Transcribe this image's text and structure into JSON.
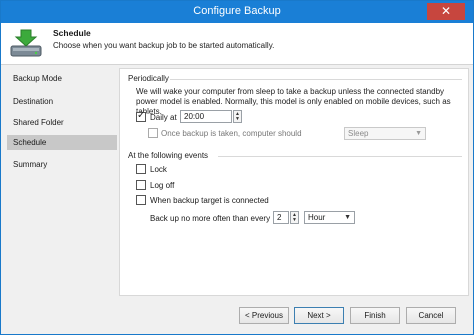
{
  "window": {
    "title": "Configure Backup",
    "close_glyph": "✕"
  },
  "header": {
    "icon": "download-to-drive-icon",
    "title": "Schedule",
    "description": "Choose when you want backup job to be started automatically."
  },
  "sidebar": {
    "items": [
      {
        "label": "Backup Mode",
        "active": false
      },
      {
        "label": "Destination",
        "active": false
      },
      {
        "label": "Shared Folder",
        "active": false
      },
      {
        "label": "Schedule",
        "active": true
      },
      {
        "label": "Summary",
        "active": false
      }
    ]
  },
  "periodically": {
    "group_title": "Periodically",
    "info": "We will wake your computer from sleep to take a backup unless the connected standby power model is enabled. Normally, this model is only enabled on mobile devices, such as tablets.",
    "daily": {
      "label": "Daily at",
      "checked": true,
      "time": "20:00"
    },
    "once": {
      "label": "Once backup is taken, computer should",
      "checked": false,
      "enabled": false,
      "action": "Sleep"
    }
  },
  "events": {
    "group_title": "At the following events",
    "lock": {
      "label": "Lock",
      "checked": false
    },
    "logoff": {
      "label": "Log off",
      "checked": false
    },
    "target": {
      "label": "When backup target is connected",
      "checked": false
    },
    "frequency": {
      "label": "Back up no more often than every",
      "value": "2",
      "unit": "Hour"
    }
  },
  "footer": {
    "previous": "< Previous",
    "next": "Next >",
    "finish": "Finish",
    "cancel": "Cancel"
  },
  "colors": {
    "title_bar": "#1a7fd6",
    "close_button": "#c7463e",
    "selected_nav": "#c8c8c8"
  }
}
